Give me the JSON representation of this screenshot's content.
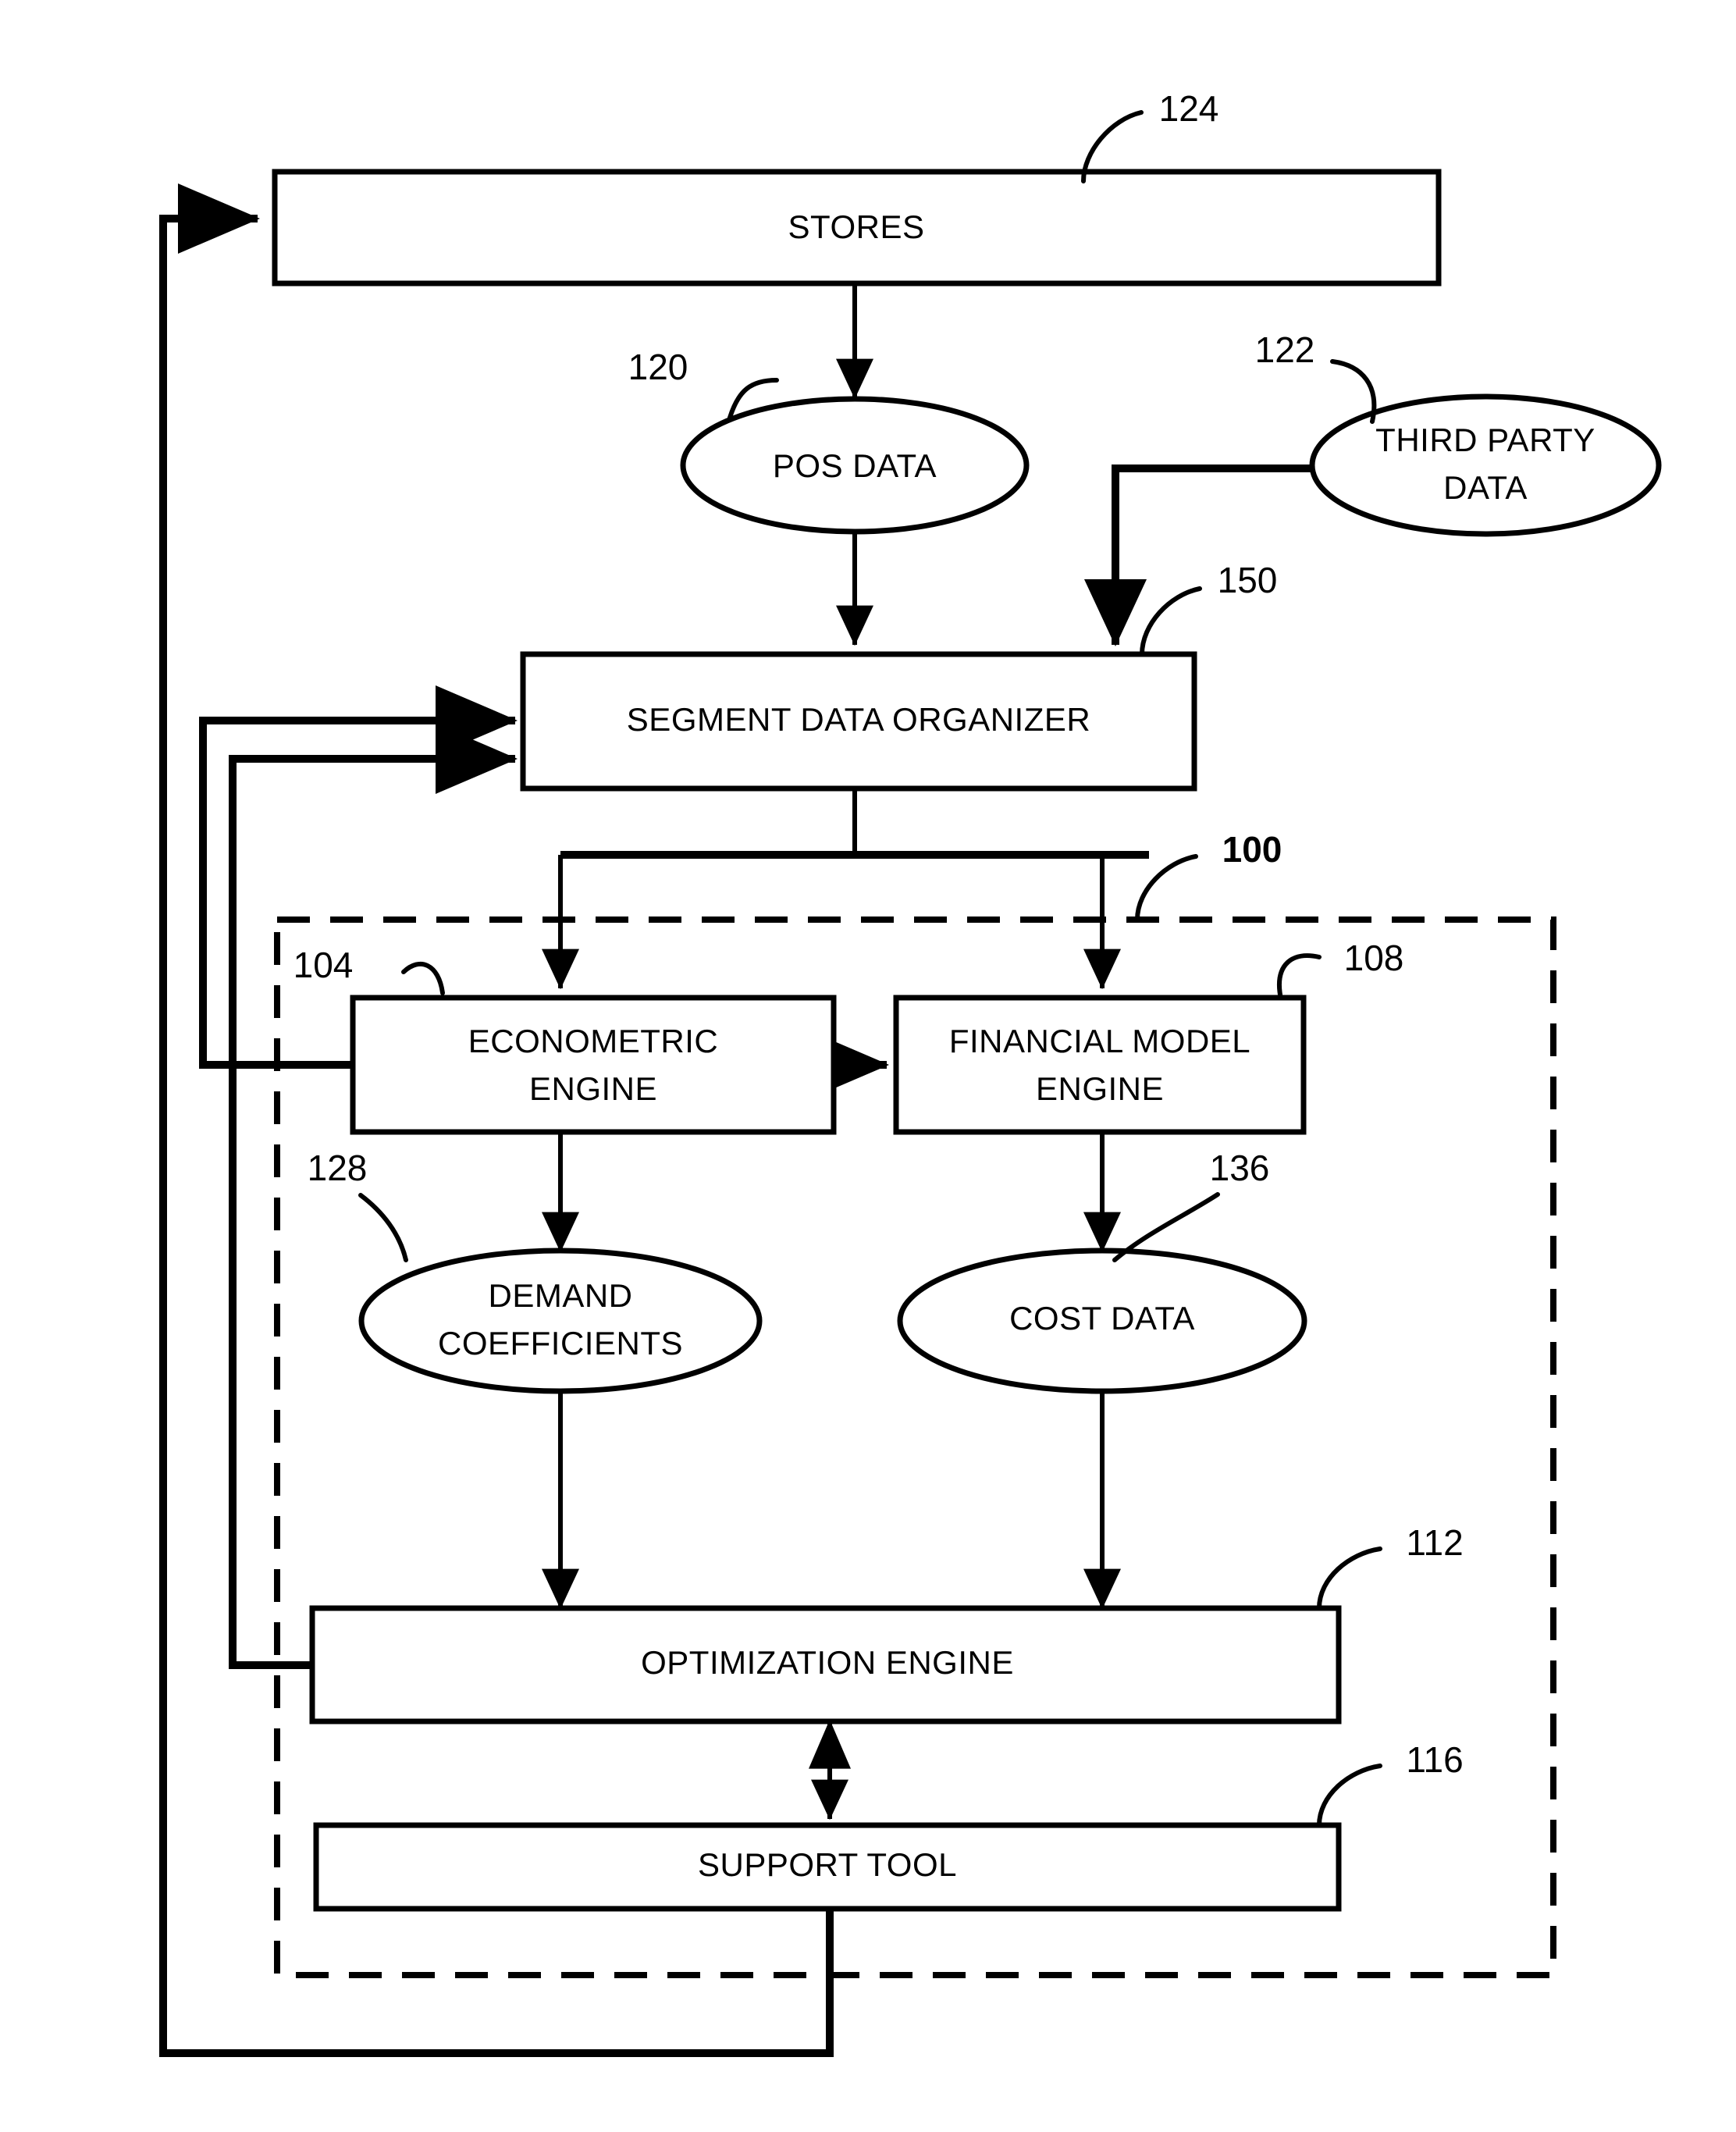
{
  "figure": {
    "type": "patent-block-diagram",
    "background_color": "#ffffff",
    "line_color": "#000000",
    "system_boundary": {
      "style": "dashed",
      "ref": "100",
      "ref_bold": true
    }
  },
  "nodes": {
    "stores": {
      "label": "STORES",
      "ref": "124",
      "shape": "rectangle"
    },
    "pos_data": {
      "label": "POS DATA",
      "ref": "120",
      "shape": "ellipse"
    },
    "third_party_data": {
      "label_line1": "THIRD PARTY",
      "label_line2": "DATA",
      "ref": "122",
      "shape": "ellipse"
    },
    "segment_data_organizer": {
      "label": "SEGMENT DATA ORGANIZER",
      "ref": "150",
      "shape": "rectangle"
    },
    "econometric_engine": {
      "label_line1": "ECONOMETRIC",
      "label_line2": "ENGINE",
      "ref": "104",
      "shape": "rectangle"
    },
    "financial_model_engine": {
      "label_line1": "FINANCIAL MODEL",
      "label_line2": "ENGINE",
      "ref": "108",
      "shape": "rectangle"
    },
    "demand_coefficients": {
      "label_line1": "DEMAND",
      "label_line2": "COEFFICIENTS",
      "ref": "128",
      "shape": "ellipse"
    },
    "cost_data": {
      "label": "COST DATA",
      "ref": "136",
      "shape": "ellipse"
    },
    "optimization_engine": {
      "label": "OPTIMIZATION ENGINE",
      "ref": "112",
      "shape": "rectangle"
    },
    "support_tool": {
      "label": "SUPPORT TOOL",
      "ref": "116",
      "shape": "rectangle"
    }
  },
  "reference_numerals": [
    {
      "id": "124",
      "text": "124"
    },
    {
      "id": "120",
      "text": "120"
    },
    {
      "id": "122",
      "text": "122"
    },
    {
      "id": "150",
      "text": "150"
    },
    {
      "id": "100",
      "text": "100"
    },
    {
      "id": "104",
      "text": "104"
    },
    {
      "id": "108",
      "text": "108"
    },
    {
      "id": "128",
      "text": "128"
    },
    {
      "id": "136",
      "text": "136"
    },
    {
      "id": "112",
      "text": "112"
    },
    {
      "id": "116",
      "text": "116"
    }
  ],
  "connections": [
    {
      "from": "stores",
      "to": "pos_data",
      "arrow": "single"
    },
    {
      "from": "pos_data",
      "to": "segment_data_organizer",
      "arrow": "single"
    },
    {
      "from": "third_party_data",
      "to": "segment_data_organizer",
      "arrow": "single"
    },
    {
      "from": "segment_data_organizer",
      "to": "econometric_engine",
      "arrow": "single"
    },
    {
      "from": "segment_data_organizer",
      "to": "financial_model_engine",
      "arrow": "single"
    },
    {
      "from": "econometric_engine",
      "to": "financial_model_engine",
      "arrow": "single"
    },
    {
      "from": "econometric_engine",
      "to": "demand_coefficients",
      "arrow": "single"
    },
    {
      "from": "financial_model_engine",
      "to": "cost_data",
      "arrow": "single"
    },
    {
      "from": "demand_coefficients",
      "to": "optimization_engine",
      "arrow": "single"
    },
    {
      "from": "cost_data",
      "to": "optimization_engine",
      "arrow": "single"
    },
    {
      "from": "optimization_engine",
      "to": "support_tool",
      "arrow": "double"
    },
    {
      "from": "support_tool",
      "to": "stores",
      "arrow": "single",
      "routing": "feedback-left-outer"
    },
    {
      "from": "econometric_engine",
      "to": "segment_data_organizer",
      "arrow": "single",
      "routing": "feedback-left-inner"
    },
    {
      "from": "optimization_engine",
      "to": "segment_data_organizer",
      "arrow": "single",
      "routing": "feedback-left-mid"
    }
  ]
}
